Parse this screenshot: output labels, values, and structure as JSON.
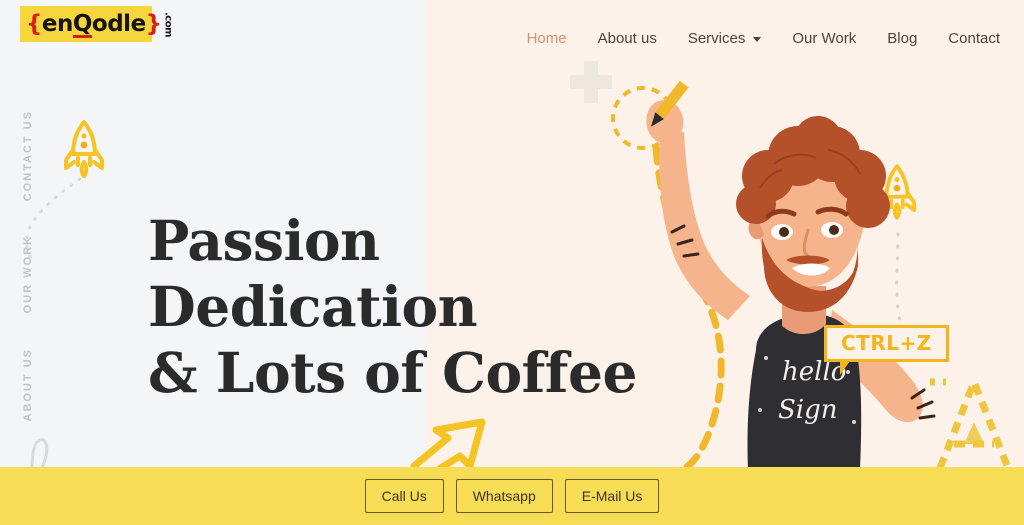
{
  "brand": {
    "open_brace": "{",
    "name_part1": "en",
    "name_q": "Q",
    "name_part2": "odle",
    "close_brace": "}",
    "tld": ".com",
    "logo_bg": "#F6D63C",
    "logo_accent": "#D81F16"
  },
  "nav": {
    "items": [
      {
        "label": "Home",
        "active": true,
        "has_dropdown": false
      },
      {
        "label": "About us",
        "active": false,
        "has_dropdown": false
      },
      {
        "label": "Services",
        "active": false,
        "has_dropdown": true
      },
      {
        "label": "Our Work",
        "active": false,
        "has_dropdown": false
      },
      {
        "label": "Blog",
        "active": false,
        "has_dropdown": false
      },
      {
        "label": "Contact",
        "active": false,
        "has_dropdown": false
      }
    ],
    "active_color": "#D9916B",
    "text_color": "#4A4440"
  },
  "side_menu": {
    "items": [
      {
        "label": "CONTACT US"
      },
      {
        "label": "OUR WORK"
      },
      {
        "label": "ABOUT US"
      }
    ]
  },
  "hero": {
    "line1": "Passion",
    "line2": "Dedication",
    "line3": "& Lots of Coffee",
    "text_color": "#2B2B2B",
    "bg_left": "#F4F5F6",
    "bg_right": "#FDF2E9"
  },
  "illustration": {
    "speech_bubble_text": "CTRL+Z",
    "speech_bubble_color": "#F4B41A",
    "shirt_text_line1": "hello",
    "shirt_text_line2": "Sign",
    "rocket_color": "#F6C324",
    "accent_yellow": "#F4B41A"
  },
  "bottom_bar": {
    "bg": "#F7DC56",
    "buttons": [
      {
        "label": "Call Us"
      },
      {
        "label": "Whatsapp"
      },
      {
        "label": "E-Mail Us"
      }
    ]
  }
}
